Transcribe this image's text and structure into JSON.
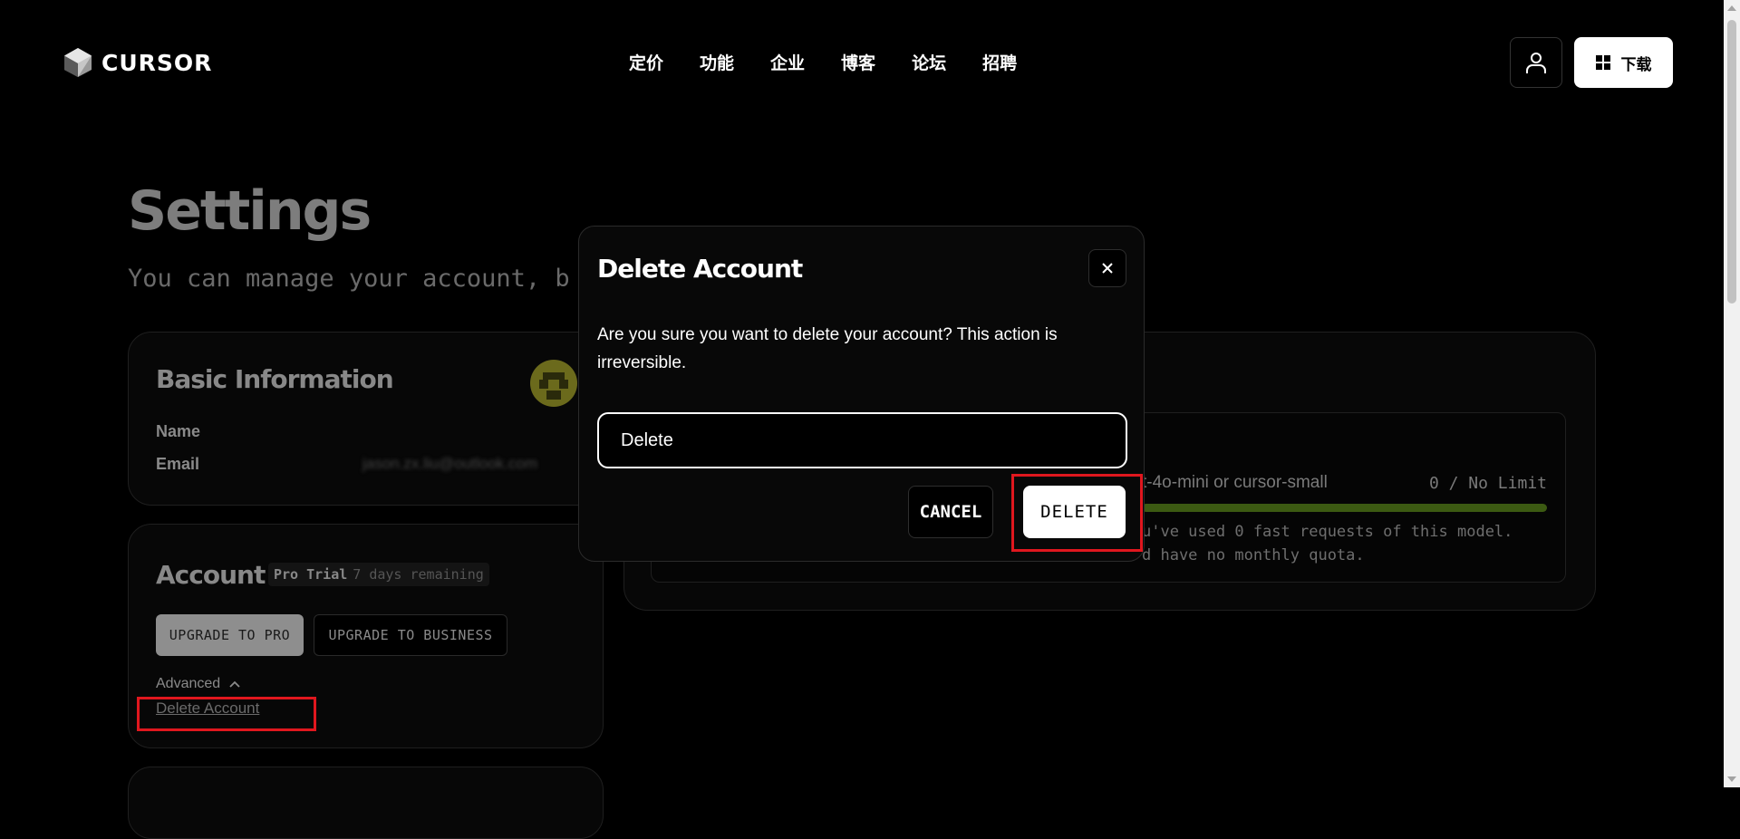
{
  "brand": {
    "name": "CURSOR"
  },
  "nav": [
    "定价",
    "功能",
    "企业",
    "博客",
    "论坛",
    "招聘"
  ],
  "header": {
    "download_label": "下载"
  },
  "page": {
    "title": "Settings",
    "subtitle": "You can manage your account, b"
  },
  "basic_info": {
    "title": "Basic Information",
    "name_label": "Name",
    "email_label": "Email",
    "email_value": "jason.zx.liu@outlook.com"
  },
  "account": {
    "title": "Account",
    "plan": "Pro Trial",
    "remaining": "7 days remaining",
    "upgrade_pro": "UPGRADE TO PRO",
    "upgrade_business": "UPGRADE TO BUSINESS",
    "advanced_label": "Advanced",
    "delete_link": "Delete Account"
  },
  "usage": {
    "model_name": "t-4o-mini or cursor-small",
    "count": "0 / No Limit",
    "progress": 0,
    "note": "u've used 0 fast requests of this model.\nd have no monthly quota."
  },
  "modal": {
    "title": "Delete Account",
    "message": "Are you sure you want to delete your account? This action is irreversible.",
    "input_value": "Delete",
    "cancel_label": "CANCEL",
    "delete_label": "DELETE"
  },
  "colors": {
    "highlight": "#e0171e",
    "progress": "#3c5a12",
    "accent_bg": "#ffffff"
  },
  "icons": {
    "logo": "cursor-cube-icon",
    "user": "user-icon",
    "windows": "windows-icon",
    "close": "close-icon",
    "chevron": "chevron-up-icon"
  }
}
